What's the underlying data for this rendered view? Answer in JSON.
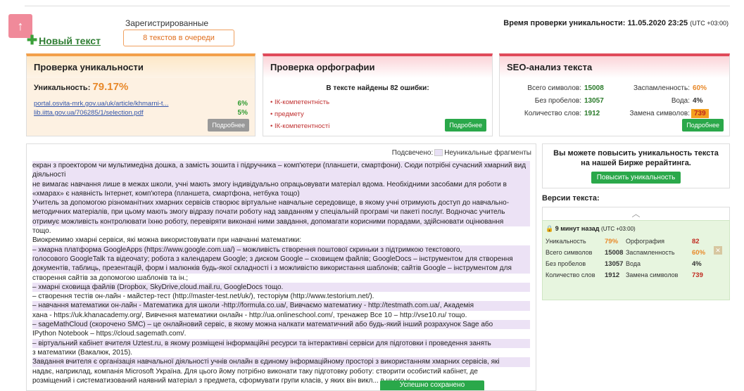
{
  "header": {
    "new_text_label": "Новый текст",
    "registered_label": "Зарегистрированные",
    "queue_label": "8 текстов в очереди",
    "check_time_label": "Время проверки уникальности: 11.05.2020 23:25",
    "check_time_tz": "(UTC +03:00)"
  },
  "uniqueness": {
    "title": "Проверка уникальности",
    "label": "Уникальность:",
    "percent": "79.17%",
    "sources": [
      {
        "url": "portal.osvita-mrk.gov.ua/uk/article/khmarni-t...",
        "pct": "6%"
      },
      {
        "url": "lib.iitta.gov.ua/706285/1/selection.pdf",
        "pct": "5%"
      }
    ],
    "details_label": "Подробнее"
  },
  "spelling": {
    "title": "Проверка орфографии",
    "summary": "В тексте найдены 82 ошибки:",
    "errors": [
      "ІК-компетентність",
      "предмету",
      "ІК-компетентності"
    ],
    "details_label": "Подробнее"
  },
  "seo": {
    "title": "SEO-анализ текста",
    "chars_label": "Всего символов:",
    "chars": "15008",
    "nospace_label": "Без пробелов:",
    "nospace": "13057",
    "words_label": "Количество слов:",
    "words": "1912",
    "spam_label": "Заспамленность:",
    "spam": "60%",
    "water_label": "Вода:",
    "water": "4%",
    "replace_label": "Замена символов:",
    "replace": "739",
    "details_label": "Подробнее"
  },
  "editor": {
    "legend_label": "Подсвечено:",
    "legend_item": "Неуникальные фрагменты",
    "lines": [
      "екран з проектором чи мультимедіна дошка, а замість зошита і підручника – комп'ютери (планшети, смартфони). Сюди потрібні сучасний хмарний вид діяльності",
      "не вимагає навчання лише в межах школи, учні мають змогу індивідуально опрацьовувати матеріал вдома. Необхідними засобами для роботи в",
      "«хмарах» є наявність Інтернет, комп'ютера (планшета, смартфона, нетбука тощо)",
      "Учитель за допомогою різноманітних хмарних сервісів створює віртуальне навчальне середовище, в якому учні отримують доступ до навчально-",
      "методичних матеріалів, при цьому мають змогу відразу почати роботу над завданням у спеціальній програмі чи пакеті послуг. Водночас учитель",
      "отримує можливість контролювати їхню роботу, перевіряти виконані ними завдання, допомагати корисними порадами, здійснювати оцінювання",
      "тощо.",
      "Виокремимо хмарні сервіси, які можна використовувати при навчанні математики:",
      "–        хмарна платформа GoogleApps (https://www.google.com.ua/) – можливість створення поштової скриньки з підтримкою текстового,",
      "голосового GoogleTalk та відеочату; робота з календарем Google; з диском Google – сховищем файлів; GoogleDocs – інструментом для створення",
      "документів, таблиць, презентацій, форм і малюнків будь-якої складності і з можливістю використання шаблонів; сайтів Google – інструментом для",
      "створення сайтів за допомогою шаблонів та ін.;",
      "–        хмарні сховища файлів (Dropbox, SkyDrive,cloud.mail.ru, GoogleDocs тощо.",
      "–        створення тестів он-лайн - майстер-тест (http://master-test.net/uk/), тесторіум (http://www.testorium.net/).",
      "–        навчання математики он-лайн - Математика для школи -http://formula.co.ua/, Вивчаємо математику - http://testmath.com.ua/, Академія",
      "хана - https://uk.khanacademy.org/, Вивчення математики онлайн - http://ua.onlineschool.com/, тренажер Все 10 – http://vse10.ru/ тощо.",
      "–        sageMathCloud (скорочено SMC) – це онлайновий сервіс, в якому можна налкати математичний або будь-який інший розрахунок Sage або",
      "IPython Notebook – https://cloud.sagemath.com/.",
      "–        віртуальний кабінет вчителя Uztest.ru, в якому розміщені інформаційні ресурси та інтерактивні сервіси для підготовки і проведення занять",
      "з математики (Вакалюк, 2015).",
      "Завдання вчителя є організація навчальної діяльності учнів онлайн в єдиному інформаційному просторі з використанням хмарних сервісів, які",
      "надає, наприклад, компанія Microsoft Україна. Для цього йому потрібно виконати таку підготовку роботу: створити особистий кабінет, де",
      "розміщений і систематизований наявний матеріал з предмета, сформувати групи класів, у яких він викл... в цього у"
    ],
    "toast": "Успешно сохранено"
  },
  "promo": {
    "text": "Вы можете повысить уникальность текста на нашей Бирже рерайтинга.",
    "button": "Повысить уникальность"
  },
  "versions": {
    "title": "Версии текста:",
    "card": {
      "time": "9 минут назад",
      "tz": "(UTC +03:00)",
      "uniq_label": "Уникальность",
      "uniq": "79%",
      "spell_label": "Орфография",
      "spell": "82",
      "chars_label": "Всего символов",
      "chars": "15008",
      "spam_label": "Заспамленность",
      "spam": "60%",
      "nospace_label": "Без пробелов",
      "nospace": "13057",
      "water_label": "Вода",
      "water": "4%",
      "words_label": "Количество слов",
      "words": "1912",
      "replace_label": "Замена символов",
      "replace": "739"
    }
  }
}
